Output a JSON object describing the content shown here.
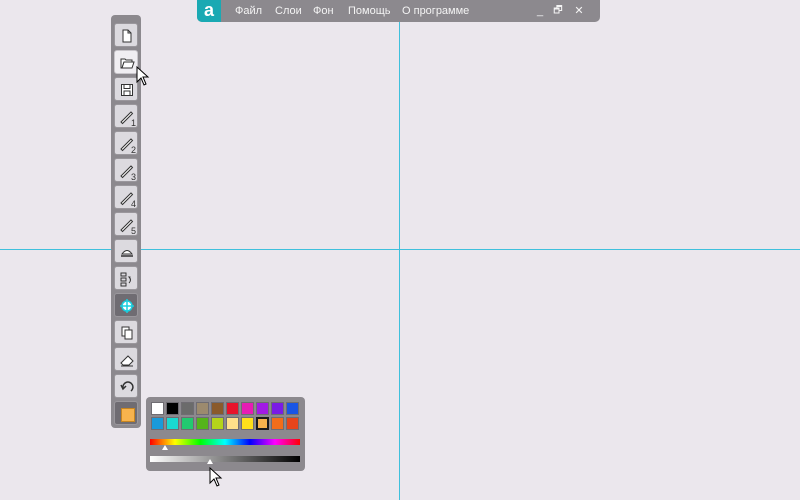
{
  "app": {
    "logo_letter": "a",
    "menu": [
      "Файл",
      "Слои",
      "Фон",
      "Помощь",
      "О программе"
    ],
    "window_controls": {
      "minimize": "_",
      "restore": "🗗",
      "close": "✕"
    }
  },
  "toolbar": {
    "tools": [
      {
        "name": "new-file",
        "icon": "file-icon"
      },
      {
        "name": "open-file",
        "icon": "folder-open-icon",
        "state": "hover"
      },
      {
        "name": "save-file",
        "icon": "save-icon"
      },
      {
        "name": "pen-1",
        "icon": "pen-icon",
        "label": "1"
      },
      {
        "name": "pen-2",
        "icon": "pen-icon",
        "label": "2"
      },
      {
        "name": "pen-3",
        "icon": "pen-icon",
        "label": "3"
      },
      {
        "name": "pen-4",
        "icon": "pen-icon",
        "label": "4"
      },
      {
        "name": "pen-5",
        "icon": "pen-icon",
        "label": "5"
      },
      {
        "name": "highlighter",
        "icon": "highlighter-icon"
      },
      {
        "name": "layers-order",
        "icon": "layers-order-icon"
      },
      {
        "name": "crosshair",
        "icon": "crosshair-icon",
        "state": "active"
      },
      {
        "name": "copy",
        "icon": "copy-icon"
      },
      {
        "name": "eraser",
        "icon": "eraser-icon"
      },
      {
        "name": "undo",
        "icon": "undo-icon"
      },
      {
        "name": "current-color",
        "icon": "color-swatch"
      }
    ],
    "current_color": "#f7b34d"
  },
  "palette": {
    "row1": [
      "#ffffff",
      "#000000",
      "#6b6b6b",
      "#9c8a6e",
      "#8a5a2b",
      "#e8132b",
      "#e61cb4",
      "#a21ae6",
      "#7a1be6",
      "#1a55e6"
    ],
    "row2": [
      "#1a9ad9",
      "#1ad9d0",
      "#22c970",
      "#55b41a",
      "#b4d41a",
      "#ffe08a",
      "#ffe01a",
      "#f7b34d",
      "#f26d1a",
      "#e8451a"
    ],
    "selected_index": 17,
    "hue_position": 0.1,
    "gray_position": 0.4
  }
}
